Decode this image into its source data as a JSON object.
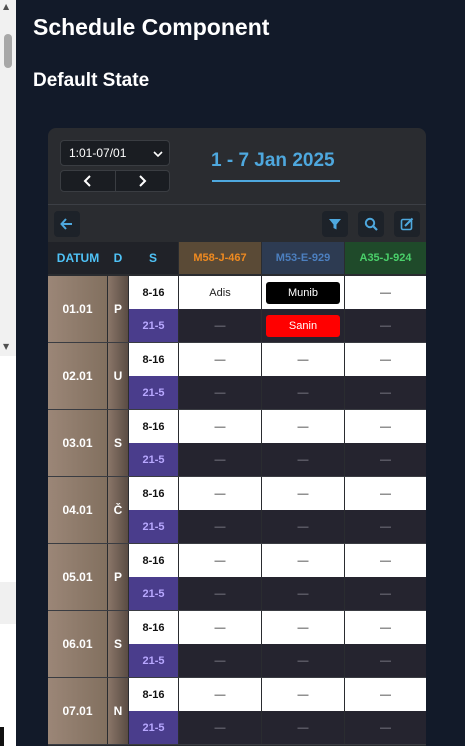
{
  "page": {
    "title": "Schedule Component",
    "section": "Default State"
  },
  "schedule": {
    "date_select": {
      "value": "1:01-07/01"
    },
    "range_title": "1 - 7 Jan 2025",
    "columns": {
      "datum": "DATUM",
      "day": "D",
      "shift": "S",
      "vehicles": [
        "M58-J-467",
        "M53-E-929",
        "A35-J-924"
      ]
    },
    "colors": {
      "vehicle_1": "#ef8a20",
      "vehicle_2": "#4c7fbf",
      "vehicle_3": "#4ad06a",
      "accent": "#4ea8de"
    },
    "days": [
      {
        "date": "01.01",
        "day": "P",
        "shift1": "8-16",
        "shift2": "21-5",
        "r1": [
          "Adis",
          "Munib",
          "—"
        ],
        "r2": [
          "—",
          "Sanin",
          "—"
        ]
      },
      {
        "date": "02.01",
        "day": "U",
        "shift1": "8-16",
        "shift2": "21-5",
        "r1": [
          "—",
          "—",
          "—"
        ],
        "r2": [
          "—",
          "—",
          "—"
        ]
      },
      {
        "date": "03.01",
        "day": "S",
        "shift1": "8-16",
        "shift2": "21-5",
        "r1": [
          "—",
          "—",
          "—"
        ],
        "r2": [
          "—",
          "—",
          "—"
        ]
      },
      {
        "date": "04.01",
        "day": "Č",
        "shift1": "8-16",
        "shift2": "21-5",
        "r1": [
          "—",
          "—",
          "—"
        ],
        "r2": [
          "—",
          "—",
          "—"
        ]
      },
      {
        "date": "05.01",
        "day": "P",
        "shift1": "8-16",
        "shift2": "21-5",
        "r1": [
          "—",
          "—",
          "—"
        ],
        "r2": [
          "—",
          "—",
          "—"
        ]
      },
      {
        "date": "06.01",
        "day": "S",
        "shift1": "8-16",
        "shift2": "21-5",
        "r1": [
          "—",
          "—",
          "—"
        ],
        "r2": [
          "—",
          "—",
          "—"
        ]
      },
      {
        "date": "07.01",
        "day": "N",
        "shift1": "8-16",
        "shift2": "21-5",
        "r1": [
          "—",
          "—",
          "—"
        ],
        "r2": [
          "—",
          "—",
          "—"
        ]
      }
    ]
  }
}
